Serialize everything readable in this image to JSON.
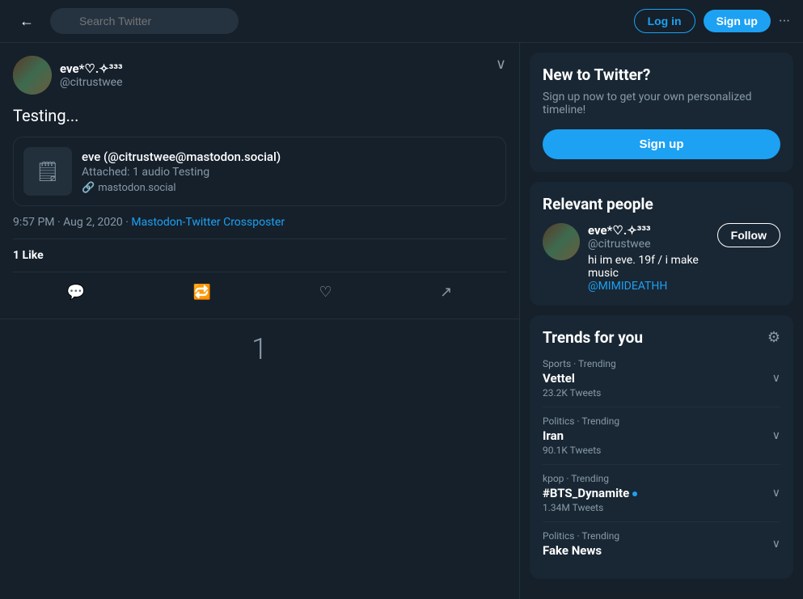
{
  "nav": {
    "back_label": "←",
    "search_placeholder": "Search Twitter",
    "login_label": "Log in",
    "signup_label": "Sign up",
    "more_label": "···"
  },
  "tweet": {
    "user_name": "eve*♡.✧³³³",
    "user_handle": "@citrustwee",
    "menu_label": "∨",
    "content": "Testing...",
    "card": {
      "icon": "🗒",
      "title": "eve (@citrustwee@mastodon.social)",
      "subtitle": "Attached: 1 audio Testing",
      "link_text": "mastodon.social"
    },
    "timestamp": "9:57 PM · Aug 2, 2020",
    "crosspost_link": "Mastodon-Twitter Crossposter",
    "likes_count": "1",
    "likes_label": "Like",
    "like_indicator": "1"
  },
  "actions": {
    "reply": "💬",
    "retweet": "🔁",
    "like": "♡",
    "share": "↗"
  },
  "new_twitter": {
    "title": "New to Twitter?",
    "subtitle": "Sign up now to get your own personalized timeline!",
    "signup_label": "Sign up"
  },
  "relevant_people": {
    "title": "Relevant people",
    "person": {
      "name": "eve*♡.✧³³³",
      "handle": "@citrustwee",
      "bio": "hi im eve. 19f / i make music",
      "bio_link": "@MIMIDEATHH",
      "follow_label": "Follow"
    }
  },
  "trends": {
    "title": "Trends for you",
    "gear_label": "⚙",
    "items": [
      {
        "category": "Sports · Trending",
        "name": "Vettel",
        "count": "23.2K Tweets",
        "has_badge": false
      },
      {
        "category": "Politics · Trending",
        "name": "Iran",
        "count": "90.1K Tweets",
        "has_badge": false
      },
      {
        "category": "kpop · Trending",
        "name": "#BTS_Dynamite",
        "count": "1.34M Tweets",
        "has_badge": true
      },
      {
        "category": "Politics · Trending",
        "name": "Fake News",
        "count": "",
        "has_badge": false
      }
    ]
  }
}
